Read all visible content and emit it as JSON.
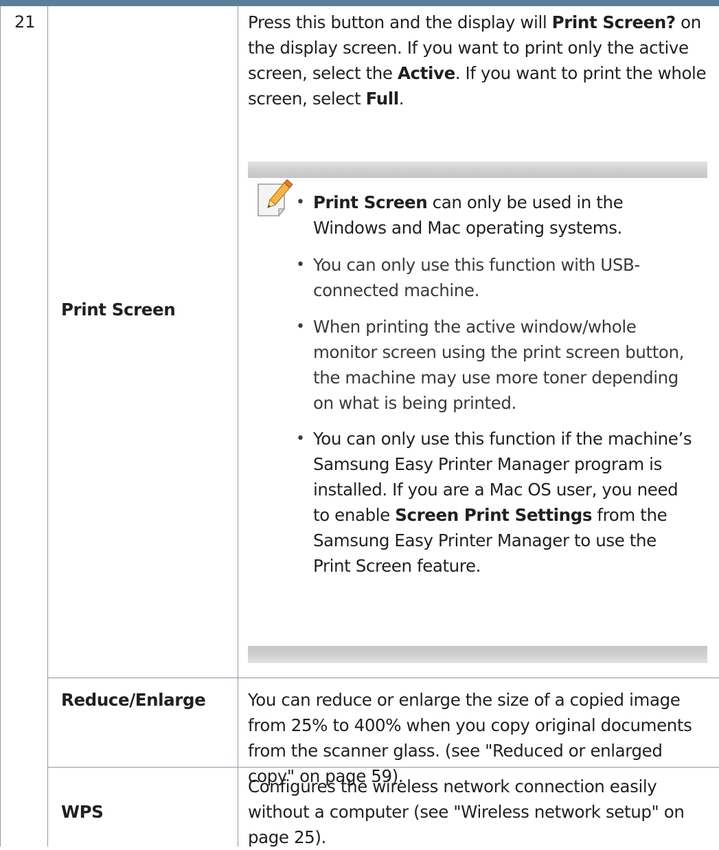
{
  "row_number": "21",
  "rows": {
    "print_screen": {
      "label": "Print Screen",
      "desc_parts": [
        "Press this button and the display will ",
        "Print Screen?",
        " on the display screen. If you want to print only the active screen, select the ",
        "Active",
        ". If you want to print the whole screen, select ",
        "Full",
        "."
      ],
      "note_bullets": [
        {
          "parts": [
            "Print Screen",
            " can only be used in the Windows and Mac operating systems."
          ]
        },
        {
          "parts": [
            "You can only use this function with USB-connected machine."
          ]
        },
        {
          "parts": [
            "When printing the active window/whole monitor screen using the print screen button, the machine may use more toner depending on what is being printed."
          ]
        },
        {
          "parts": [
            "You can only use this function if the machine’s ",
            "Samsung Easy Printer Manager",
            " program is installed. If you are a Mac OS user, you need to enable ",
            "Screen Print Settings",
            " from the Samsung Easy Printer Manager",
            " to use the Print Screen feature."
          ]
        }
      ]
    },
    "reduce_enlarge": {
      "label": "Reduce/Enlarge",
      "desc": "You can reduce or enlarge the size of a copied image from 25% to 400% when you copy original documents from the scanner glass. (see \"Reduced or enlarged copy\" on page 59)."
    },
    "wps": {
      "label": "WPS",
      "desc": "Configures the wireless network connection easily without a computer (see \"Wireless network setup\" on page 25)."
    }
  },
  "icons": {
    "note": "note-pencil-icon"
  },
  "colors": {
    "header_bar": "#5c7f99",
    "rule": "#8d9aa6",
    "note_bar": "#d0d0d0",
    "text": "#231f20"
  }
}
